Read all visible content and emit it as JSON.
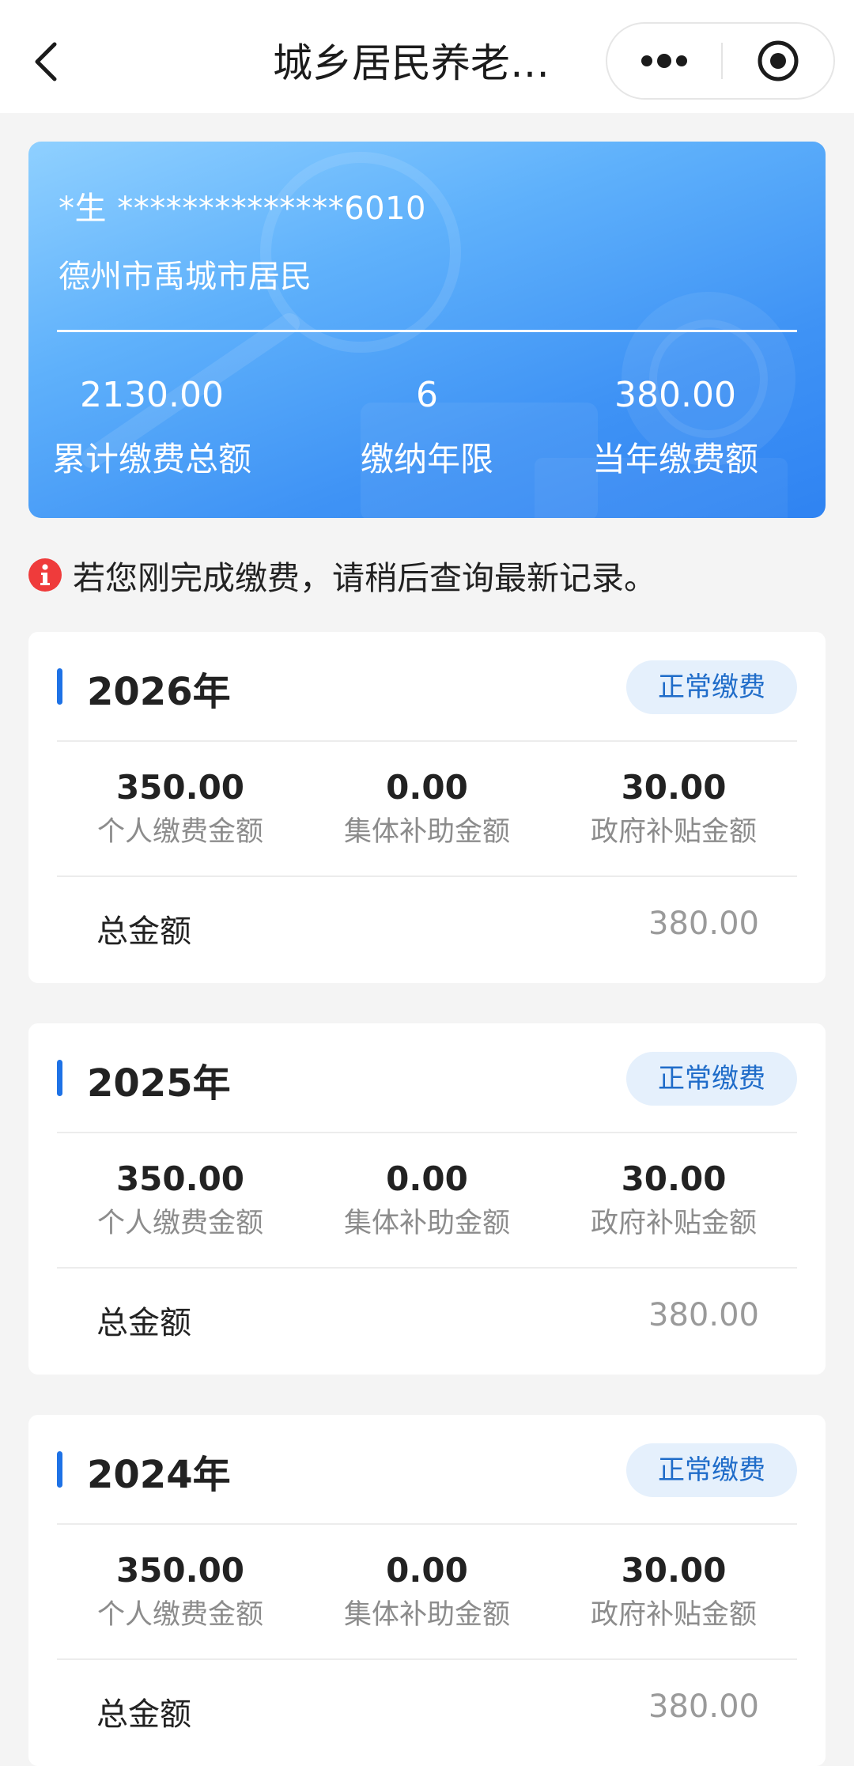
{
  "navbar": {
    "title": "城乡居民养老…"
  },
  "summary": {
    "name": "*生 **************6010",
    "region": "德州市禹城市居民",
    "stats": [
      {
        "value": "2130.00",
        "label": "累计缴费总额"
      },
      {
        "value": "6",
        "label": "缴纳年限"
      },
      {
        "value": "380.00",
        "label": "当年缴费额"
      }
    ]
  },
  "notice": {
    "text": "若您刚完成缴费，请稍后查询最新记录。",
    "icon": "info-icon",
    "icon_glyph": "i"
  },
  "records": [
    {
      "year": "2026年",
      "status": "正常缴费",
      "amounts": [
        {
          "value": "350.00",
          "label": "个人缴费金额"
        },
        {
          "value": "0.00",
          "label": "集体补助金额"
        },
        {
          "value": "30.00",
          "label": "政府补贴金额"
        }
      ],
      "total_label": "总金额",
      "total_value": "380.00"
    },
    {
      "year": "2025年",
      "status": "正常缴费",
      "amounts": [
        {
          "value": "350.00",
          "label": "个人缴费金额"
        },
        {
          "value": "0.00",
          "label": "集体补助金额"
        },
        {
          "value": "30.00",
          "label": "政府补贴金额"
        }
      ],
      "total_label": "总金额",
      "total_value": "380.00"
    },
    {
      "year": "2024年",
      "status": "正常缴费",
      "amounts": [
        {
          "value": "350.00",
          "label": "个人缴费金额"
        },
        {
          "value": "0.00",
          "label": "集体补助金额"
        },
        {
          "value": "30.00",
          "label": "政府补贴金额"
        }
      ],
      "total_label": "总金额",
      "total_value": "380.00"
    }
  ],
  "colors": {
    "accent": "#1e72e6",
    "badge_bg": "#e5f0fc",
    "badge_text": "#1f6cc9",
    "notice_icon": "#ef3b3b",
    "card_gradient_start": "#8fd0ff",
    "card_gradient_end": "#2f83f2"
  }
}
